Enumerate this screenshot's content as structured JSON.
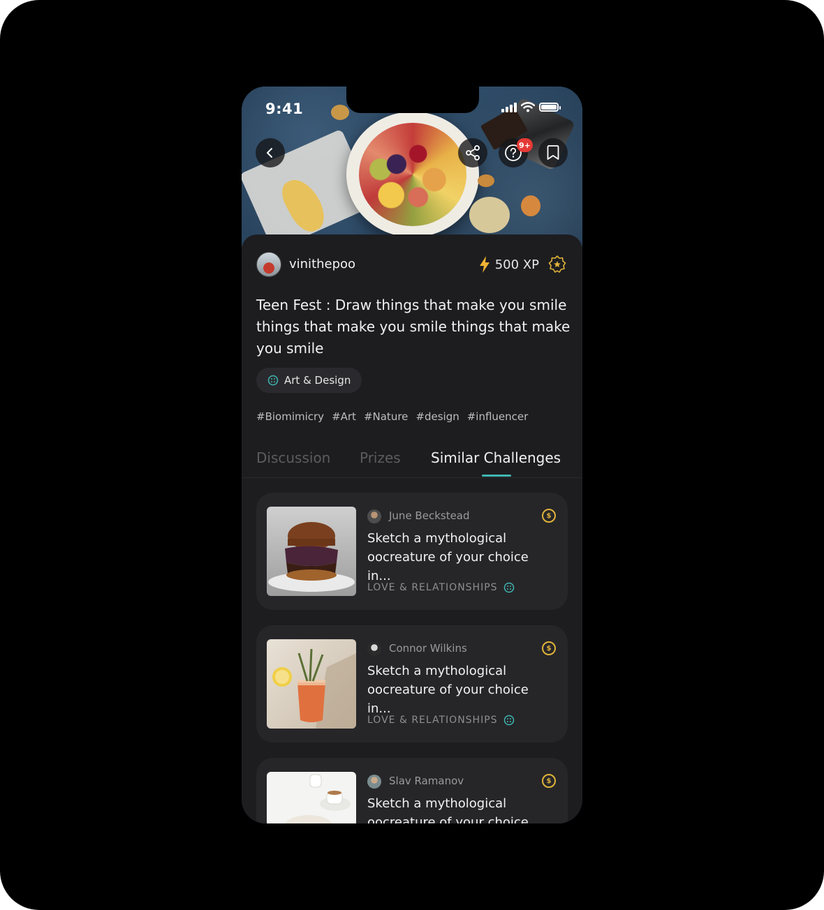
{
  "status_bar": {
    "time": "9:41"
  },
  "header": {
    "back_icon": "chevron-left-icon",
    "share_icon": "share-icon",
    "help_icon": "question-circle-icon",
    "help_badge": "9+",
    "bookmark_icon": "bookmark-icon"
  },
  "post": {
    "username": "vinithepoo",
    "xp": "500 XP",
    "title": "Teen Fest : Draw things that make you smile things that make you smile things that make you smile",
    "category": "Art & Design",
    "hashtags": [
      "#Biomimicry",
      "#Art",
      "#Nature",
      "#design",
      "#influencer"
    ]
  },
  "tabs": [
    {
      "label": "Discussion",
      "active": false
    },
    {
      "label": "Prizes",
      "active": false
    },
    {
      "label": "Similar Challenges",
      "active": true
    }
  ],
  "challenges": [
    {
      "author": "June Beckstead",
      "title": "Sketch a mythological oocreature of your choice in...",
      "category": "LOVE & RELATIONSHIPS",
      "coin": "$",
      "image": "burger"
    },
    {
      "author": "Connor Wilkins",
      "title": "Sketch a mythological oocreature of your choice in...",
      "category": "LOVE & RELATIONSHIPS",
      "coin": "$",
      "image": "cocktail"
    },
    {
      "author": "Slav Ramanov",
      "title": "Sketch a mythological oocreature of your choice in...",
      "category": "",
      "coin": "$",
      "image": "coffee"
    }
  ],
  "colors": {
    "accent": "#3fb7b0",
    "gold": "#e1b33a",
    "background": "#1d1d20",
    "card": "#262629",
    "badge": "#e53935"
  }
}
